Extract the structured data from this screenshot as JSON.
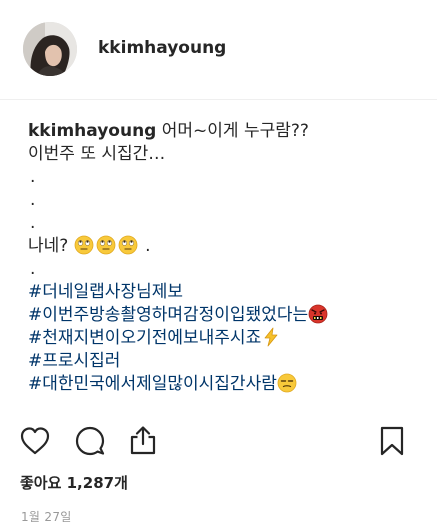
{
  "post": {
    "username": "kkimhayoung",
    "caption": {
      "username": "kkimhayoung",
      "first_line": " 어머~이게 누구람??",
      "line2": "이번주 또 시집간…",
      "dot": ".",
      "nane": "나네?",
      "hashtags": [
        "#더네일랩사장님제보",
        "#이번주방송촬영하며감정이입됐었다는",
        "#천재지변이오기전에보내주시죠",
        "#프로시집러",
        "#대한민국에서제일많이시집간사람"
      ]
    },
    "likes_text": "좋아요 1,287개",
    "date": "1월 27일"
  },
  "icons": {
    "heart": "heart-icon",
    "comment": "comment-icon",
    "share": "share-icon",
    "bookmark": "bookmark-icon",
    "eye_roll": "face-with-rolling-eyes-emoji",
    "angry": "swearing-face-emoji",
    "lightning": "high-voltage-emoji",
    "grimace": "unamused-face-emoji"
  }
}
